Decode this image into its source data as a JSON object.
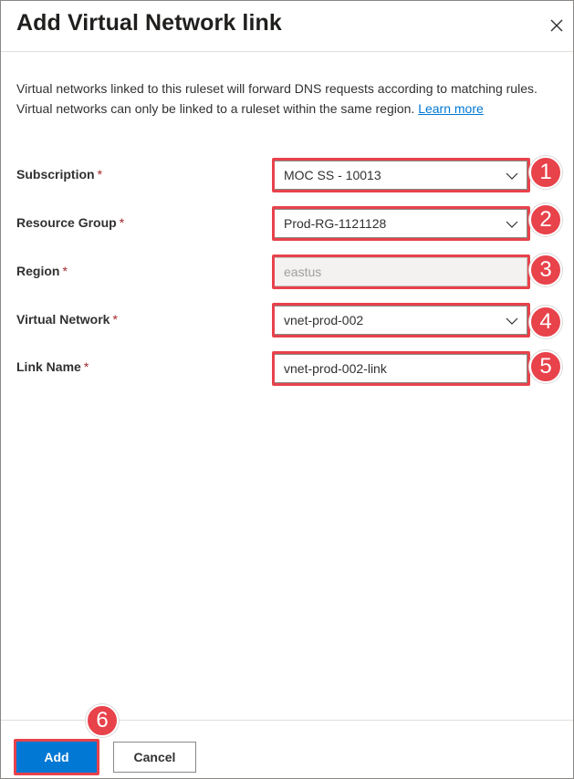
{
  "dialog": {
    "title": "Add Virtual Network link",
    "close_icon": "close-icon",
    "description_line1": "Virtual networks linked to this ruleset will forward DNS requests according to matching rules.",
    "description_line2": "Virtual networks can only be linked to a ruleset within the same region.",
    "learn_more": "Learn more"
  },
  "form": {
    "required_marker": "*",
    "subscription": {
      "label": "Subscription",
      "value": "MOC SS - 10013",
      "badge": "1"
    },
    "resource_group": {
      "label": "Resource Group",
      "value": "Prod-RG-1121128",
      "badge": "2"
    },
    "region": {
      "label": "Region",
      "value": "eastus",
      "badge": "3"
    },
    "virtual_network": {
      "label": "Virtual Network",
      "value": "vnet-prod-002",
      "badge": "4"
    },
    "link_name": {
      "label": "Link Name",
      "value": "vnet-prod-002-link",
      "badge": "5"
    }
  },
  "footer": {
    "add_label": "Add",
    "cancel_label": "Cancel",
    "add_badge": "6"
  },
  "colors": {
    "accent": "#0078d4",
    "highlight": "#e8424b",
    "required": "#a4262c"
  }
}
